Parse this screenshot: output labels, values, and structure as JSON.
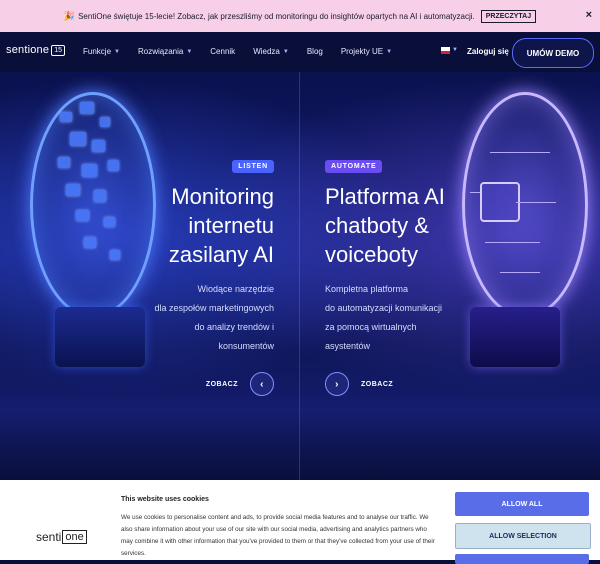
{
  "announcement": {
    "emoji": "🎉",
    "text": "SentiOne świętuje 15-lecie! Zobacz, jak przeszliśmy od monitoringu do insightów opartych na AI i automatyzacji.",
    "button": "PRZECZYTAJ",
    "close": "×"
  },
  "nav": {
    "logo_text": "sentione",
    "logo_badge": "15",
    "items": [
      {
        "label": "Funkcje",
        "caret": true
      },
      {
        "label": "Rozwiązania",
        "caret": true
      },
      {
        "label": "Cennik",
        "caret": false
      },
      {
        "label": "Wiedza",
        "caret": true
      },
      {
        "label": "Blog",
        "caret": false
      },
      {
        "label": "Projekty UE",
        "caret": true
      }
    ],
    "login": "Zaloguj się",
    "demo": "UMÓW DEMO"
  },
  "hero": {
    "left": {
      "tag": "LISTEN",
      "title_lines": [
        "Monitoring",
        "internetu",
        "zasilany AI"
      ],
      "desc_lines": [
        "Wiodące narzędzie",
        "dla zespołów marketingowych",
        "do analizy trendów i",
        "konsumentów"
      ],
      "cta": "ZOBACZ",
      "cta_icon": "‹"
    },
    "right": {
      "tag": "AUTOMATE",
      "title_lines": [
        "Platforma AI",
        "chatboty &",
        "voiceboty"
      ],
      "desc_lines": [
        "Kompletna platforma",
        "do automatyzacji komunikacji",
        "za pomocą wirtualnych",
        "asystentów"
      ],
      "cta": "ZOBACZ",
      "cta_icon": "›"
    }
  },
  "cookie": {
    "logo": "senti",
    "logo_box": "one",
    "title": "This website uses cookies",
    "text": "We use cookies to personalise content and ads, to provide social media features and to analyse our traffic. We also share information about your use of our site with our social media, advertising and analytics partners who may combine it with other information that you've provided to them or that they've collected from your use of their services.",
    "allow_all": "ALLOW ALL",
    "allow_selection": "ALLOW SELECTION"
  }
}
